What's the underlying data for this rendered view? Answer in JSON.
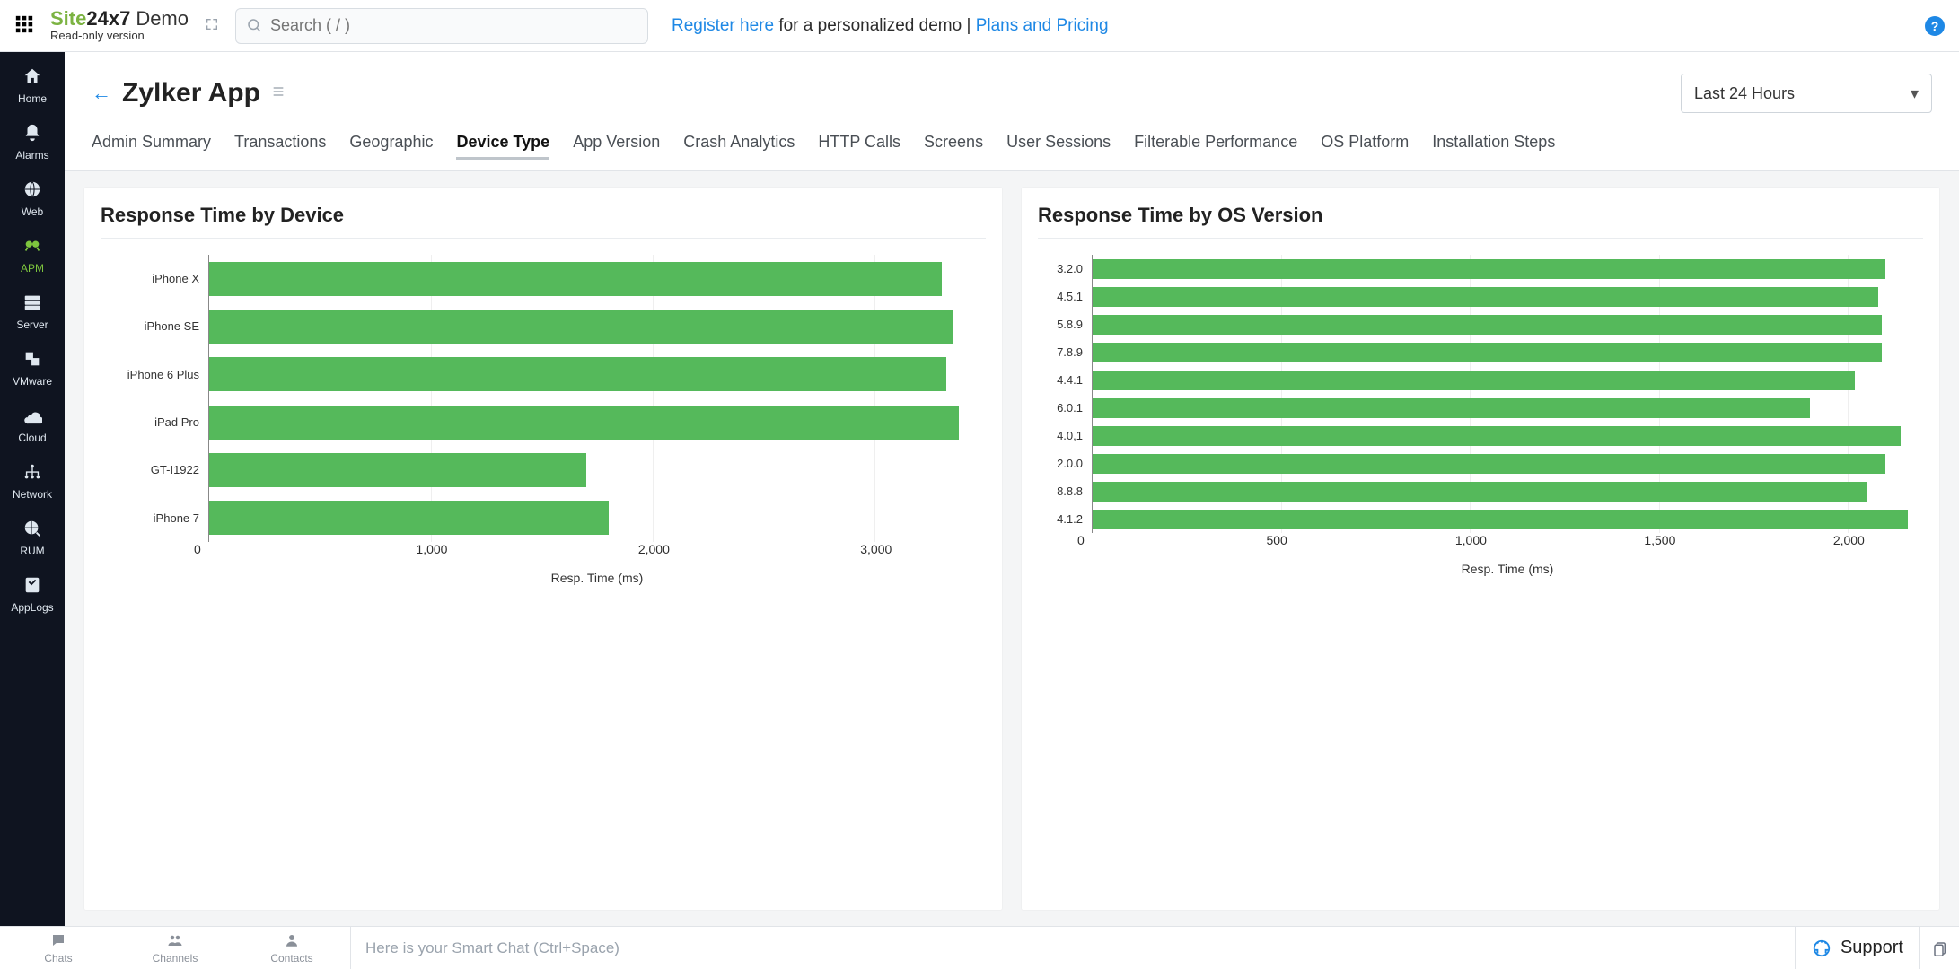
{
  "header": {
    "brand_site": "Site",
    "brand_247": "24x7",
    "brand_demo": "Demo",
    "readonly": "Read-only version",
    "search_placeholder": "Search ( / )",
    "promo_register": "Register here",
    "promo_mid": " for a personalized demo | ",
    "promo_plans": "Plans and Pricing"
  },
  "sidebar": {
    "items": [
      {
        "label": "Home"
      },
      {
        "label": "Alarms"
      },
      {
        "label": "Web"
      },
      {
        "label": "APM"
      },
      {
        "label": "Server"
      },
      {
        "label": "VMware"
      },
      {
        "label": "Cloud"
      },
      {
        "label": "Network"
      },
      {
        "label": "RUM"
      },
      {
        "label": "AppLogs"
      }
    ],
    "active_index": 3
  },
  "page": {
    "title": "Zylker App",
    "timerange": "Last 24 Hours"
  },
  "tabs": {
    "items": [
      "Admin Summary",
      "Transactions",
      "Geographic",
      "Device Type",
      "App Version",
      "Crash Analytics",
      "HTTP Calls",
      "Screens",
      "User Sessions",
      "Filterable Performance",
      "OS Platform",
      "Installation Steps"
    ],
    "active_index": 3
  },
  "chart_data": [
    {
      "type": "bar",
      "orientation": "horizontal",
      "title": "Response Time by Device",
      "categories": [
        "iPhone X",
        "iPhone SE",
        "iPhone 6 Plus",
        "iPad Pro",
        "GT-I1922",
        "iPhone 7"
      ],
      "values": [
        3300,
        3350,
        3320,
        3380,
        1700,
        1800
      ],
      "xlabel": "Resp. Time (ms)",
      "ylabel": "",
      "xlim": [
        0,
        3500
      ],
      "xticks": [
        0,
        1000,
        2000,
        3000
      ],
      "xtick_labels": [
        "0",
        "1,000",
        "2,000",
        "3,000"
      ],
      "color": "#55b95b"
    },
    {
      "type": "bar",
      "orientation": "horizontal",
      "title": "Response Time by OS Version",
      "categories": [
        "3.2.0",
        "4.5.1",
        "5.8.9",
        "7.8.9",
        "4.4.1",
        "6.0.1",
        "4.0,1",
        "2.0.0",
        "8.8.8",
        "4.1.2"
      ],
      "values": [
        2100,
        2080,
        2090,
        2090,
        2020,
        1900,
        2140,
        2100,
        2050,
        2160
      ],
      "xlabel": "Resp. Time (ms)",
      "ylabel": "",
      "xlim": [
        0,
        2200
      ],
      "xticks": [
        0,
        500,
        1000,
        1500,
        2000
      ],
      "xtick_labels": [
        "0",
        "500",
        "1,000",
        "1,500",
        "2,000"
      ],
      "color": "#55b95b"
    }
  ],
  "bottombar": {
    "items": [
      {
        "label": "Chats"
      },
      {
        "label": "Channels"
      },
      {
        "label": "Contacts"
      }
    ],
    "smart_placeholder": "Here is your Smart Chat (Ctrl+Space)",
    "support": "Support"
  }
}
